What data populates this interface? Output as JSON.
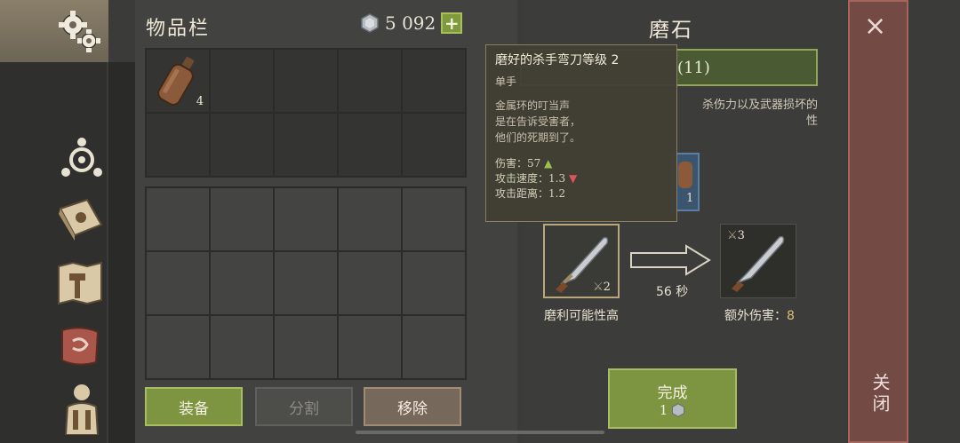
{
  "inventory": {
    "title": "物品栏",
    "currency_value": "5 092",
    "plus_label": "+",
    "items": [
      {
        "name": "bottle",
        "qty": "4"
      }
    ],
    "buttons": {
      "equip": "装备",
      "split": "分割",
      "remove": "移除"
    }
  },
  "crafting": {
    "title": "磨石",
    "recipe_count": "(11)",
    "description": "杀伤力以及武器损坏的\n性",
    "material_qty": "1",
    "input_level": "2",
    "input_label": "磨利可能性高",
    "time": "56 秒",
    "output_level": "3",
    "output_label": "额外伤害：",
    "output_bonus": "8",
    "finish_label": "完成",
    "finish_cost": "1"
  },
  "tooltip": {
    "title": "磨好的杀手弯刀等级 2",
    "subtitle": "单手",
    "flavor": [
      "金属环的叮当声",
      "是在告诉受害者，",
      "他们的死期到了。"
    ],
    "stats": [
      {
        "label": "伤害：",
        "value": "57",
        "trend": "▲"
      },
      {
        "label": "攻击速度：",
        "value": "1.3",
        "trend": "▼"
      },
      {
        "label": "攻击距离：",
        "value": "1.2",
        "trend": ""
      }
    ]
  },
  "close": {
    "label": "关闭",
    "x": "×"
  },
  "colors": {
    "accent_green": "#7d9441",
    "close_red": "#744a45",
    "positive": "#9bc04c",
    "negative": "#d9565b"
  }
}
